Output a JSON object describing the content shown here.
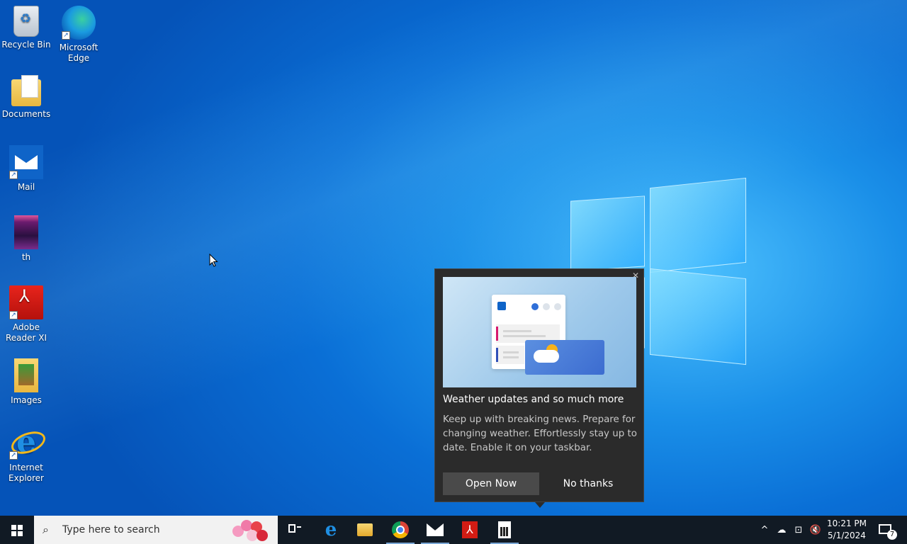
{
  "desktop": {
    "icons": [
      {
        "label_line1": "Recycle Bin",
        "label_line2": ""
      },
      {
        "label_line1": "Microsoft",
        "label_line2": "Edge"
      },
      {
        "label_line1": "Documents",
        "label_line2": ""
      },
      {
        "label_line1": "Mail",
        "label_line2": ""
      },
      {
        "label_line1": "th",
        "label_line2": ""
      },
      {
        "label_line1": "Adobe",
        "label_line2": "Reader XI"
      },
      {
        "label_line1": "Images",
        "label_line2": ""
      },
      {
        "label_line1": "Internet",
        "label_line2": "Explorer"
      }
    ]
  },
  "popup": {
    "close": "✕",
    "title": "Weather updates and so much more",
    "body": "Keep up with breaking news. Prepare for changing weather. Effortlessly stay up to date. Enable it on your taskbar.",
    "open_label": "Open Now",
    "decline_label": "No thanks"
  },
  "taskbar": {
    "search_placeholder": "Type here to search",
    "pinned": [
      "task-view",
      "edge",
      "file-explorer",
      "chrome",
      "mail",
      "adobe-reader",
      "calculator"
    ],
    "tray": {
      "chevron": "^",
      "time": "10:21 PM",
      "date": "5/1/2024",
      "notification_count": "7"
    }
  },
  "colors": {
    "taskbar": "#111a24",
    "popup_bg": "#2b2b2b",
    "open_button": "#4a4a4a"
  }
}
